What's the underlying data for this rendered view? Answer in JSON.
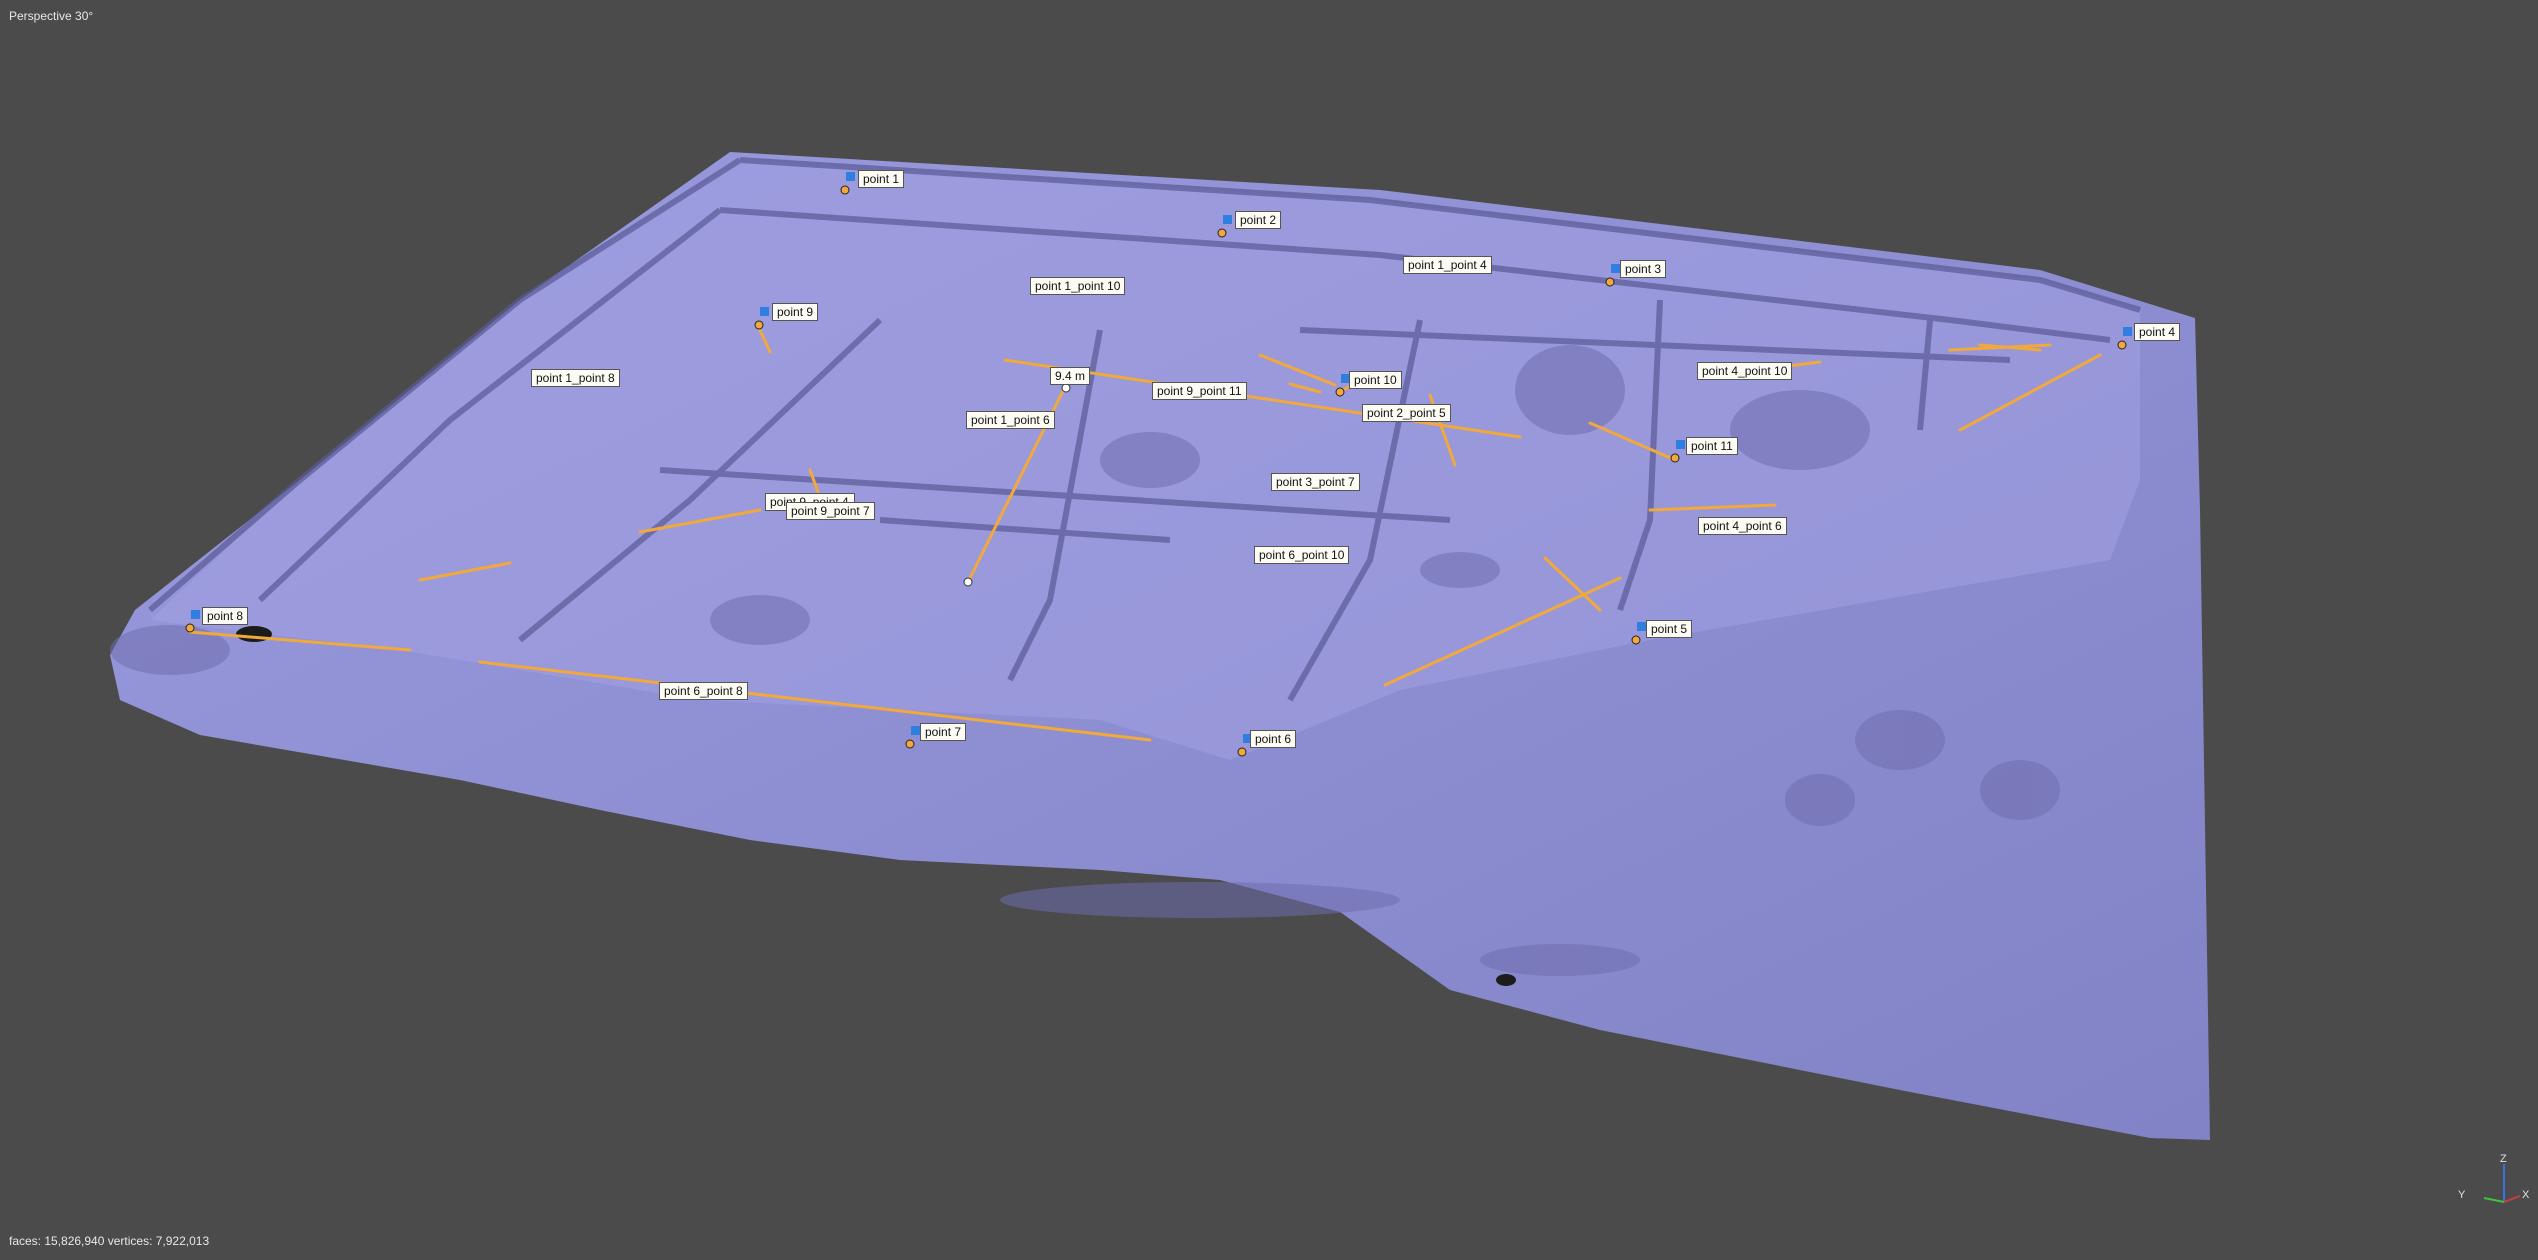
{
  "viewport": {
    "view_mode": "Perspective 30°",
    "stats": "faces: 15,826,940 vertices: 7,922,013",
    "background_color": "#4b4b4b",
    "mesh_color": "#8e8ed2",
    "measure_line_color": "#f2a93b",
    "marker_color": "#2f7fe0"
  },
  "markers": [
    {
      "id": "m1",
      "label": "point 1"
    },
    {
      "id": "m2",
      "label": "point 2"
    },
    {
      "id": "m3",
      "label": "point 3"
    },
    {
      "id": "m4",
      "label": "point 4"
    },
    {
      "id": "m5",
      "label": "point 5"
    },
    {
      "id": "m6",
      "label": "point 6"
    },
    {
      "id": "m7",
      "label": "point 7"
    },
    {
      "id": "m8",
      "label": "point 8"
    },
    {
      "id": "m9",
      "label": "point 9"
    },
    {
      "id": "m10",
      "label": "point 10"
    },
    {
      "id": "m11",
      "label": "point 11"
    }
  ],
  "measurements": [
    {
      "id": "l1",
      "label": "point 1_point 10"
    },
    {
      "id": "l2",
      "label": "point 1_point 4"
    },
    {
      "id": "l3",
      "label": "point 1_point 8"
    },
    {
      "id": "l4",
      "label": "point 1_point 6"
    },
    {
      "id": "l5",
      "label": "point 9_point 11"
    },
    {
      "id": "l6",
      "label": "point 2_point 5"
    },
    {
      "id": "l7",
      "label": "point 4_point 10"
    },
    {
      "id": "l8",
      "label": "point 3_point 7"
    },
    {
      "id": "l9",
      "label": "point 9_point 7"
    },
    {
      "id": "l10",
      "label": "point 6_point 10"
    },
    {
      "id": "l11",
      "label": "point 4_point 6"
    },
    {
      "id": "l12",
      "label": "point 6_point 8"
    },
    {
      "id": "l13",
      "label": "point 9_point 4"
    }
  ],
  "active_measurement": {
    "value": "9.4 m"
  },
  "axis_gizmo": {
    "x": "X",
    "y": "Y",
    "z": "Z"
  }
}
